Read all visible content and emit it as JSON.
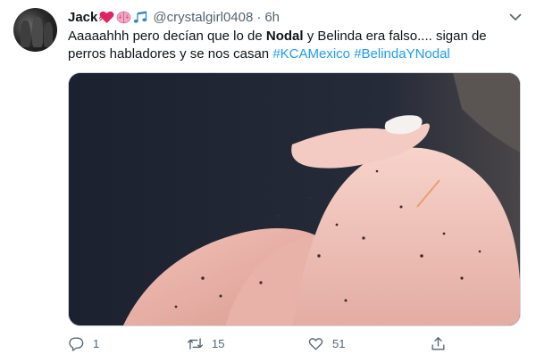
{
  "tweet": {
    "author_name": "Jack",
    "handle": "@crystalgirl0408",
    "separator": "·",
    "time": "6h",
    "text_parts": [
      {
        "key": "p1",
        "text": "Aaaaahhh pero decían que lo de "
      },
      {
        "key": "p2",
        "text": "Nodal"
      },
      {
        "key": "p3",
        "text": " y Belinda era falso.... sigan de perros habladores y se nos casan "
      },
      {
        "key": "p4",
        "text": "#KCAMexico"
      },
      {
        "key": "p5",
        "text": " "
      },
      {
        "key": "p6",
        "text": "#BelindaYNodal"
      }
    ],
    "replies": "1",
    "retweets": "15",
    "likes": "51"
  },
  "icons": {
    "more": "more-chevron-icon",
    "reply": "reply-icon",
    "retweet": "retweet-icon",
    "like": "like-icon",
    "share": "share-icon",
    "emoji": [
      "heart-emoji",
      "brain-emoji",
      "music-notes-emoji"
    ]
  },
  "colors": {
    "link": "#1d9bf0",
    "secondary_text": "#536471",
    "heart_emoji": "#e0245e",
    "brain_emoji": "#f28cb1",
    "music_emoji": "#3b88c3"
  }
}
